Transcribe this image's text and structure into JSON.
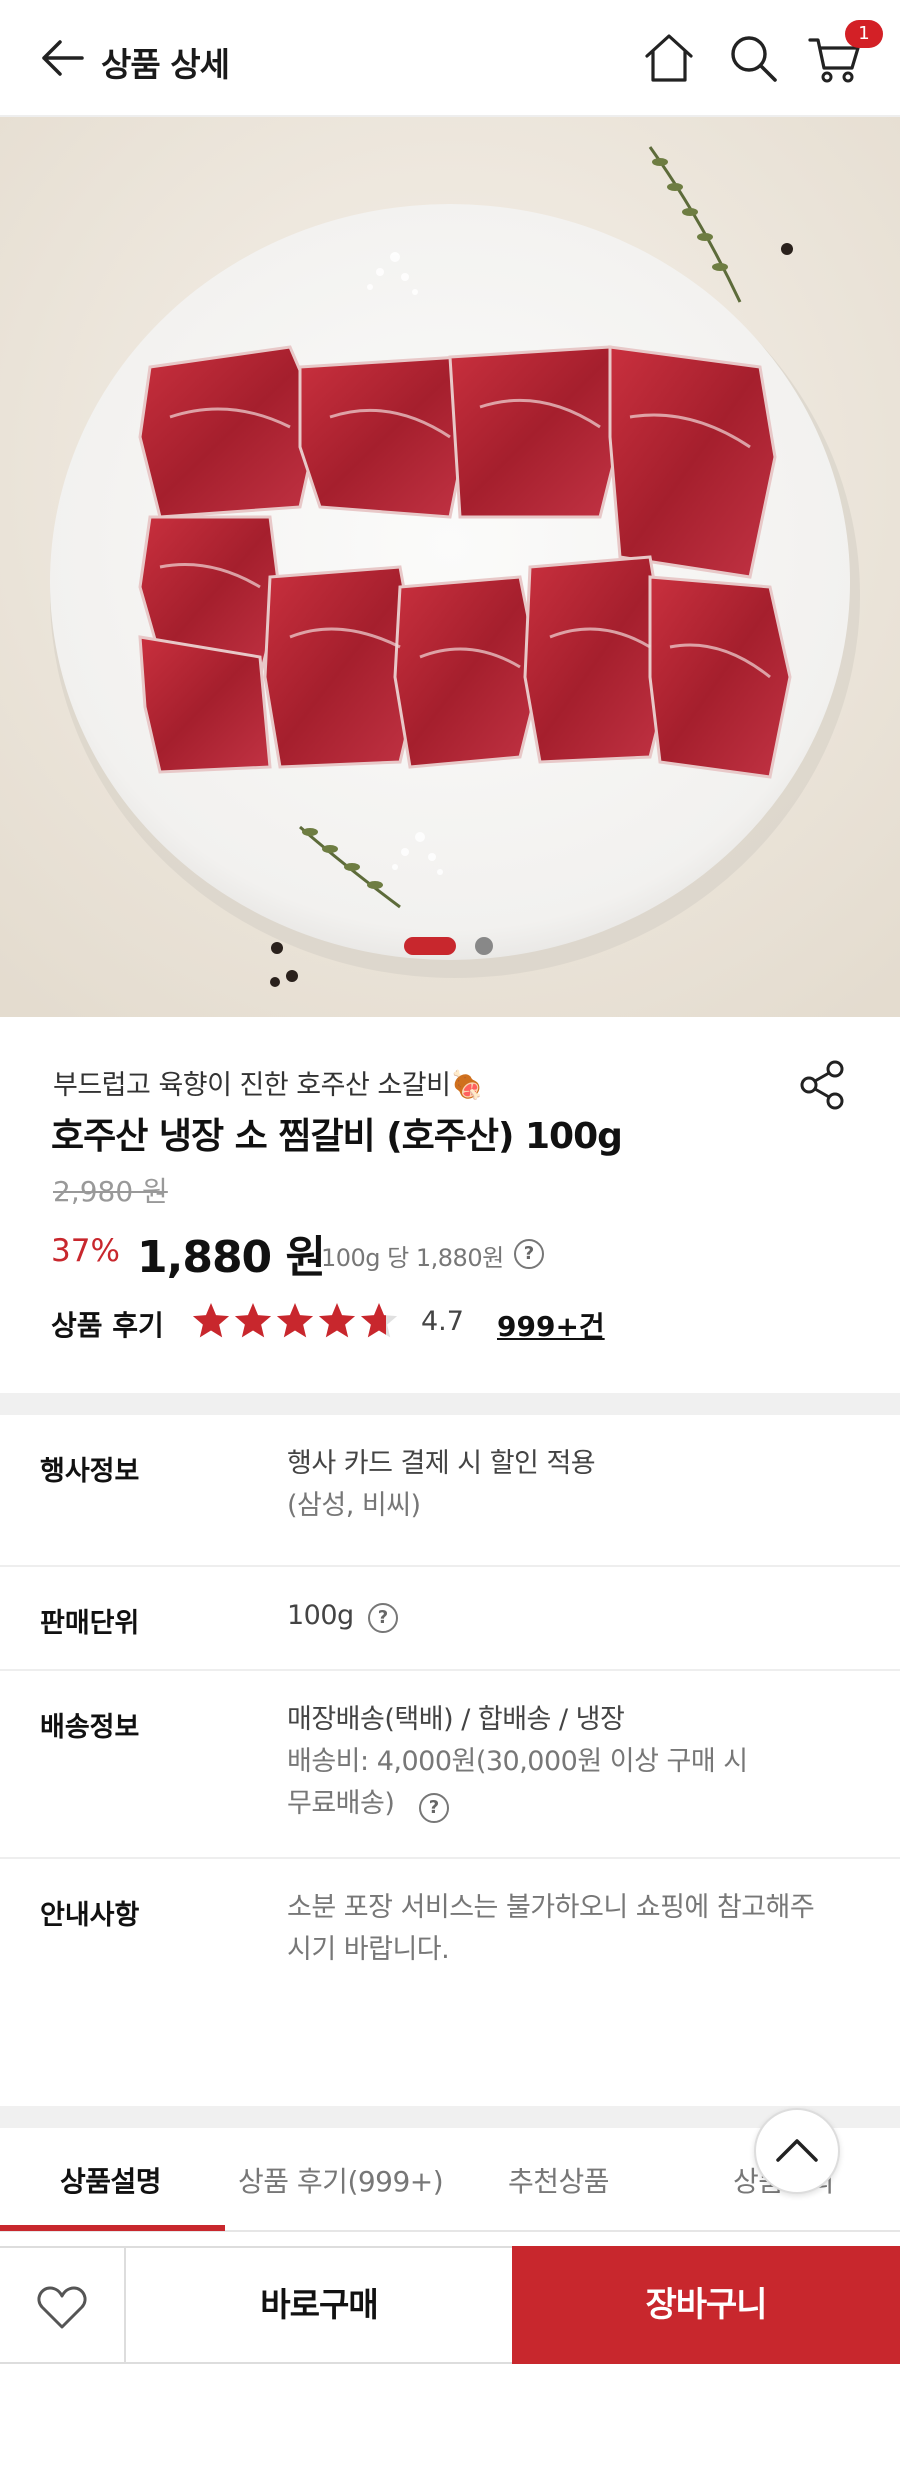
{
  "header": {
    "title": "상품 상세",
    "cart_count": "1"
  },
  "gallery": {
    "total_slides": 2,
    "active_slide": 1
  },
  "product": {
    "subtitle": "부드럽고 육향이 진한 호주산 소갈비🍖",
    "name": "호주산 냉장 소 찜갈비 (호주산) 100g",
    "original_price": "2,980 원",
    "discount": "37%",
    "price": "1,880 원",
    "unit_price": "100g 당 1,880원",
    "review_label": "상품 후기",
    "rating": "4.7",
    "rating_value": 4.7,
    "rating_max": 5,
    "review_count": "999+건"
  },
  "specs": [
    {
      "label": "행사정보",
      "value": "행사 카드 결제 시 할인 적용",
      "sub": "(삼성, 비씨)"
    },
    {
      "label": "판매단위",
      "value": "100g"
    },
    {
      "label": "배송정보",
      "value": "매장배송(택배) / 합배송 / 냉장",
      "sub1": "배송비: 4,000원(30,000원 이상 구매 시",
      "sub2": "무료배송)"
    },
    {
      "label": "안내사항",
      "value1": "소분 포장 서비스는 불가하오니 쇼핑에 참고해주",
      "value2": "시기 바랍니다."
    }
  ],
  "tabs": [
    "상품설명",
    "상품 후기(999+)",
    "추천상품",
    "상품문의"
  ],
  "bottom": {
    "buy_now": "바로구매",
    "add_to_cart": "장바구니"
  },
  "colors": {
    "accent": "#c8272d",
    "badge": "#d32026"
  }
}
